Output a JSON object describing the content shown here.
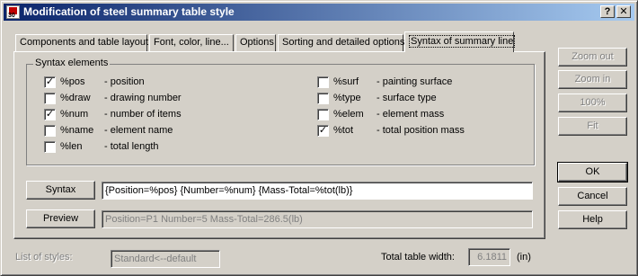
{
  "window": {
    "title": "Modification of steel summary table style",
    "help_label": "?",
    "close_label": "✕"
  },
  "tabs": [
    {
      "label": "Components and table layout"
    },
    {
      "label": "Font, color, line..."
    },
    {
      "label": "Options"
    },
    {
      "label": "Sorting and detailed options"
    },
    {
      "label": "Syntax of summary line"
    }
  ],
  "syntax_elements": {
    "title": "Syntax elements",
    "left": [
      {
        "code": "%pos",
        "desc": "- position",
        "checked": "✓"
      },
      {
        "code": "%draw",
        "desc": "- drawing number",
        "checked": ""
      },
      {
        "code": "%num",
        "desc": "- number of items",
        "checked": "✓"
      },
      {
        "code": "%name",
        "desc": "- element name",
        "checked": ""
      },
      {
        "code": "%len",
        "desc": "- total length",
        "checked": ""
      }
    ],
    "right": [
      {
        "code": "%surf",
        "desc": "- painting surface",
        "checked": ""
      },
      {
        "code": "%type",
        "desc": "- surface type",
        "checked": ""
      },
      {
        "code": "%elem",
        "desc": "- element mass",
        "checked": ""
      },
      {
        "code": "%tot",
        "desc": "- total position mass",
        "checked": "✓"
      }
    ]
  },
  "syntax": {
    "button_label": "Syntax",
    "value": "{Position=%pos}    {Number=%num}    {Mass-Total=%tot(lb)}"
  },
  "preview": {
    "button_label": "Preview",
    "value": "Position=P1    Number=5    Mass-Total=286.5(lb)"
  },
  "side_buttons": {
    "zoom_out": "Zoom out",
    "zoom_in": "Zoom in",
    "zoom_100": "100%",
    "fit": "Fit",
    "ok": "OK",
    "cancel": "Cancel",
    "help": "Help"
  },
  "footer": {
    "list_of_styles_label": "List of styles:",
    "list_of_styles_value": "Standard<--default",
    "total_width_label": "Total table width:",
    "total_width_value": "6.1811",
    "total_width_unit": "(in)"
  }
}
